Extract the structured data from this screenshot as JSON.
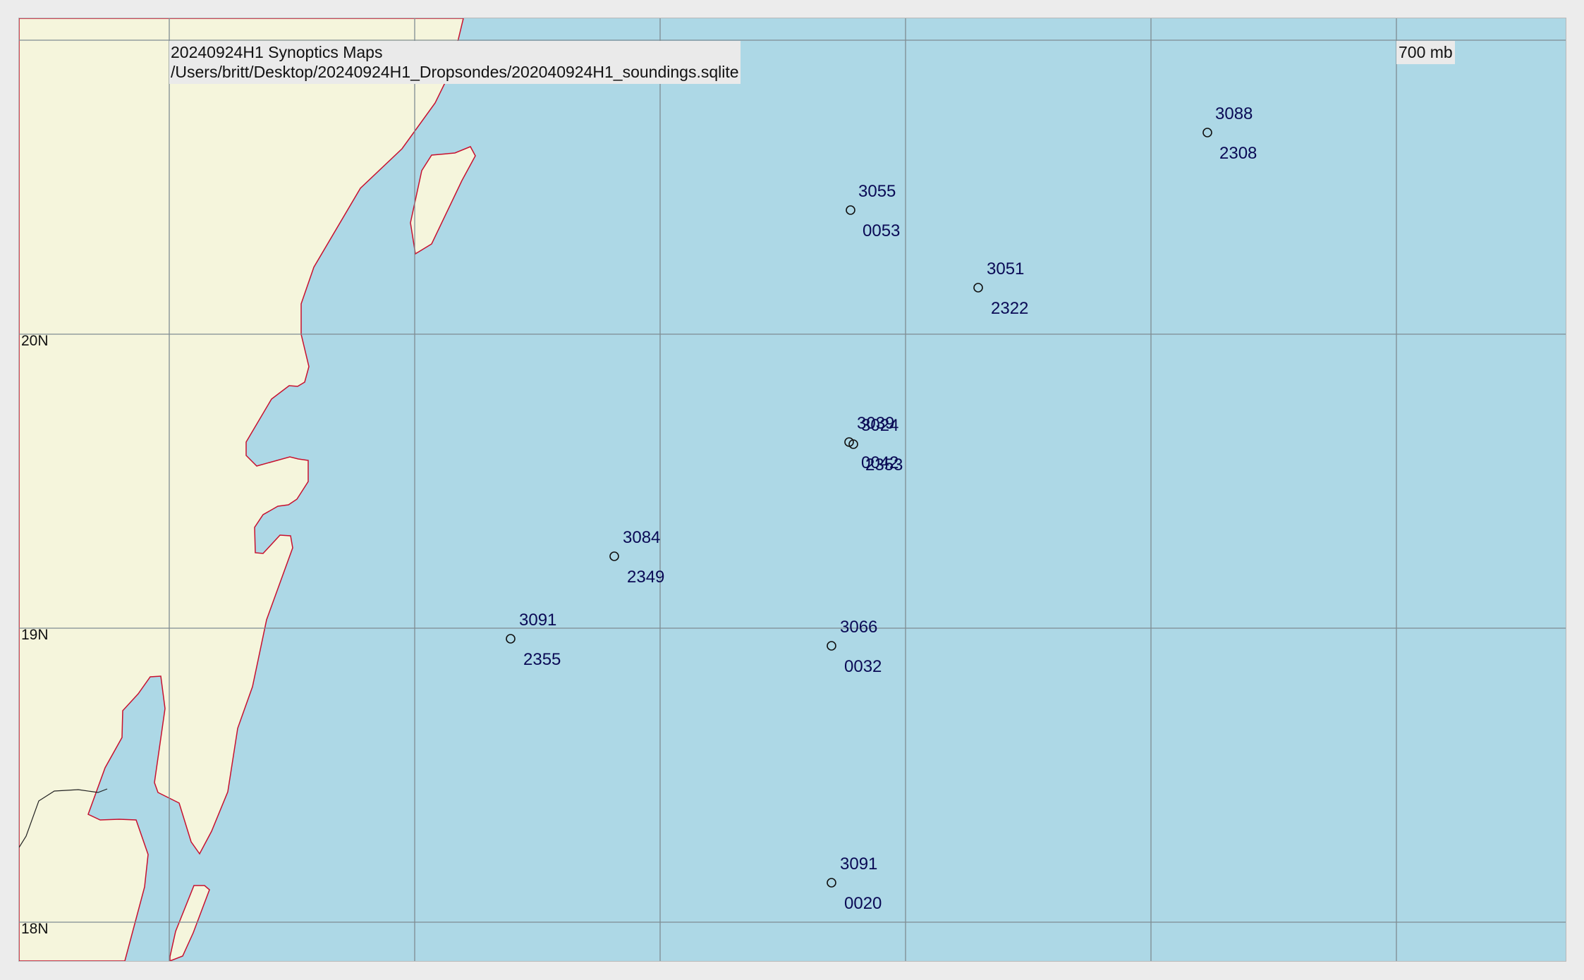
{
  "header": {
    "title": "20240924H1 Synoptics Maps",
    "path": "/Users/britt/Desktop/20240924H1_Dropsondes/202040924H1_soundings.sqlite",
    "level": "700 mb"
  },
  "colors": {
    "ocean": "#add8e6",
    "land": "#f5f5dc",
    "coastline": "#c8102e",
    "border": "#000000",
    "grid": "#7f8c92",
    "station_text": "#0a0a55"
  },
  "lat_labels": [
    "20N",
    "19N",
    "18N"
  ],
  "stations": [
    {
      "id": "3088",
      "time": "2308"
    },
    {
      "id": "3055",
      "time": "0053"
    },
    {
      "id": "3051",
      "time": "2322"
    },
    {
      "id": "3039",
      "time": "0042"
    },
    {
      "id": "3024",
      "time": "2353"
    },
    {
      "id": "3084",
      "time": "2349"
    },
    {
      "id": "3091",
      "time": "2355"
    },
    {
      "id": "3066",
      "time": "0032"
    },
    {
      "id": "3091",
      "time": "0020"
    }
  ]
}
